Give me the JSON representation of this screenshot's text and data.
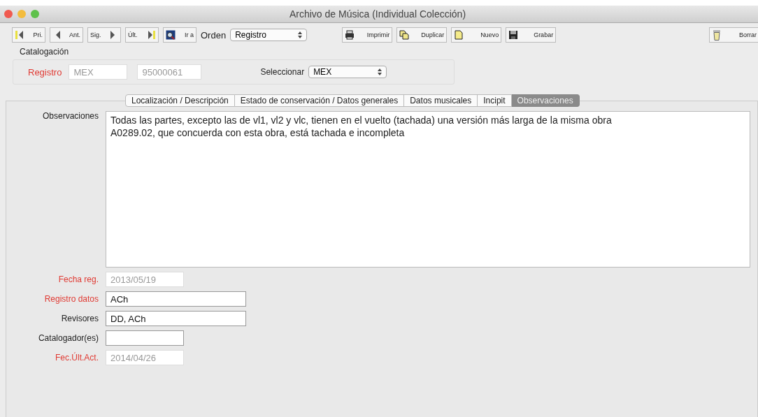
{
  "window": {
    "title": "Archivo de Música (Individual Colección)"
  },
  "toolbar": {
    "nav": [
      {
        "label": "Pri.",
        "kind": "first"
      },
      {
        "label": "Ant.",
        "kind": "prev"
      },
      {
        "label": "Sig.",
        "kind": "next"
      },
      {
        "label": "Últ.",
        "kind": "last"
      },
      {
        "label": "Ir a",
        "kind": "goto"
      }
    ],
    "order_label": "Orden",
    "order_value": "Registro",
    "actions": [
      {
        "label": "Imprimir",
        "kind": "print"
      },
      {
        "label": "Duplicar",
        "kind": "duplicate"
      },
      {
        "label": "Nuevo",
        "kind": "new"
      },
      {
        "label": "Grabar",
        "kind": "save"
      }
    ],
    "delete": {
      "label": "Borrar",
      "kind": "trash"
    }
  },
  "catalog": {
    "title": "Catalogación",
    "label": "Registro",
    "prefix": "MEX",
    "number": "95000061",
    "select_label": "Seleccionar",
    "select_value": "MEX"
  },
  "tabs": [
    {
      "label": "Localización / Descripción",
      "selected": false
    },
    {
      "label": "Estado de conservación / Datos generales",
      "selected": false
    },
    {
      "label": "Datos musicales",
      "selected": false
    },
    {
      "label": "Incipit",
      "selected": false
    },
    {
      "label": "Observaciones",
      "selected": true
    }
  ],
  "notes": {
    "label": "Observaciones",
    "value": "Todas las partes, excepto las de vl1, vl2 y vlc, tienen en el vuelto (tachada) una versión más larga de la misma obra\nA0289.02, que concuerda con esta obra, está tachada e incompleta"
  },
  "fields": [
    {
      "label": "Fecha reg.",
      "value": "2013/05/19",
      "required": true,
      "disabled": true,
      "wide": false
    },
    {
      "label": "Registro datos",
      "value": "ACh",
      "required": true,
      "disabled": false,
      "wide": true
    },
    {
      "label": "Revisores",
      "value": "DD, ACh",
      "required": false,
      "disabled": false,
      "wide": true
    },
    {
      "label": "Catalogador(es)",
      "required": false,
      "disabled": false,
      "wide": false
    },
    {
      "label": "Fec.Últ.Act.",
      "value": "2014/04/26",
      "required": true,
      "disabled": true,
      "wide": false
    }
  ]
}
